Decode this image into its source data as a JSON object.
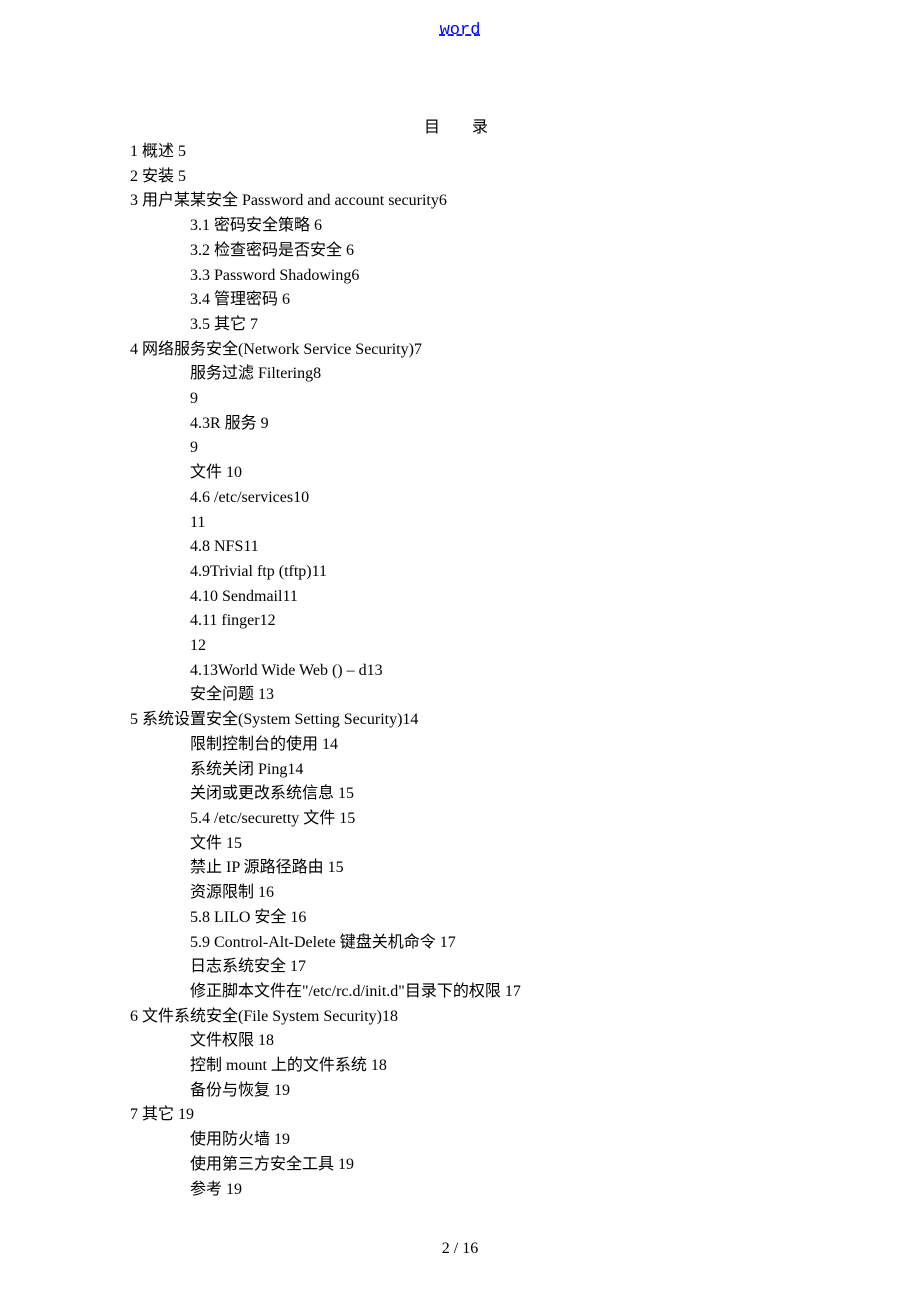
{
  "header": {
    "link": "word"
  },
  "toc": {
    "title": "目　录",
    "entries": [
      {
        "text": "1 概述 5",
        "level": 1
      },
      {
        "text": "2  安装 5",
        "level": 1
      },
      {
        "text": "3  用户某某安全 Password and account security6",
        "level": 1
      },
      {
        "text": "3.1  密码安全策略 6",
        "level": 2
      },
      {
        "text": "3.2  检查密码是否安全 6",
        "level": 2
      },
      {
        "text": "3.3 Password Shadowing6",
        "level": 2
      },
      {
        "text": "3.4  管理密码 6",
        "level": 2
      },
      {
        "text": "3.5  其它 7",
        "level": 2
      },
      {
        "text": "4  网络服务安全(Network Service Security)7",
        "level": 1
      },
      {
        "text": "服务过滤 Filtering8",
        "level": 2
      },
      {
        "text": "9",
        "level": 2
      },
      {
        "text": "4.3R  服务 9",
        "level": 2
      },
      {
        "text": "9",
        "level": 2
      },
      {
        "text": "文件 10",
        "level": 2
      },
      {
        "text": "4.6 /etc/services10",
        "level": 2
      },
      {
        "text": "11",
        "level": 2
      },
      {
        "text": "4.8 NFS11",
        "level": 2
      },
      {
        "text": "4.9Trivial ftp (tftp)11",
        "level": 2
      },
      {
        "text": "4.10 Sendmail11",
        "level": 2
      },
      {
        "text": "4.11 finger12",
        "level": 2
      },
      {
        "text": "12",
        "level": 2
      },
      {
        "text": "4.13World Wide Web () – d13",
        "level": 2
      },
      {
        "text": "安全问题 13",
        "level": 2
      },
      {
        "text": "5 系统设置安全(System Setting Security)14",
        "level": 1
      },
      {
        "text": "限制控制台的使用 14",
        "level": 2
      },
      {
        "text": "系统关闭 Ping14",
        "level": 2
      },
      {
        "text": "关闭或更改系统信息 15",
        "level": 2
      },
      {
        "text": "5.4 /etc/securetty 文件 15",
        "level": 2
      },
      {
        "text": "文件 15",
        "level": 2
      },
      {
        "text": "禁止 IP 源路径路由 15",
        "level": 2
      },
      {
        "text": "资源限制 16",
        "level": 2
      },
      {
        "text": "5.8 LILO 安全 16",
        "level": 2
      },
      {
        "text": "5.9 Control-Alt-Delete  键盘关机命令 17",
        "level": 2
      },
      {
        "text": "日志系统安全 17",
        "level": 2
      },
      {
        "text": "修正脚本文件在\"/etc/rc.d/init.d\"目录下的权限 17",
        "level": 2
      },
      {
        "text": "6 文件系统安全(File System Security)18",
        "level": 1
      },
      {
        "text": "文件权限 18",
        "level": 2
      },
      {
        "text": "控制 mount 上的文件系统 18",
        "level": 2
      },
      {
        "text": "备份与恢复 19",
        "level": 2
      },
      {
        "text": "7 其它 19",
        "level": 1
      },
      {
        "text": "使用防火墙 19",
        "level": 2
      },
      {
        "text": "使用第三方安全工具 19",
        "level": 2
      },
      {
        "text": "参考 19",
        "level": 2
      }
    ]
  },
  "footer": {
    "pageNumber": "2 / 16"
  }
}
